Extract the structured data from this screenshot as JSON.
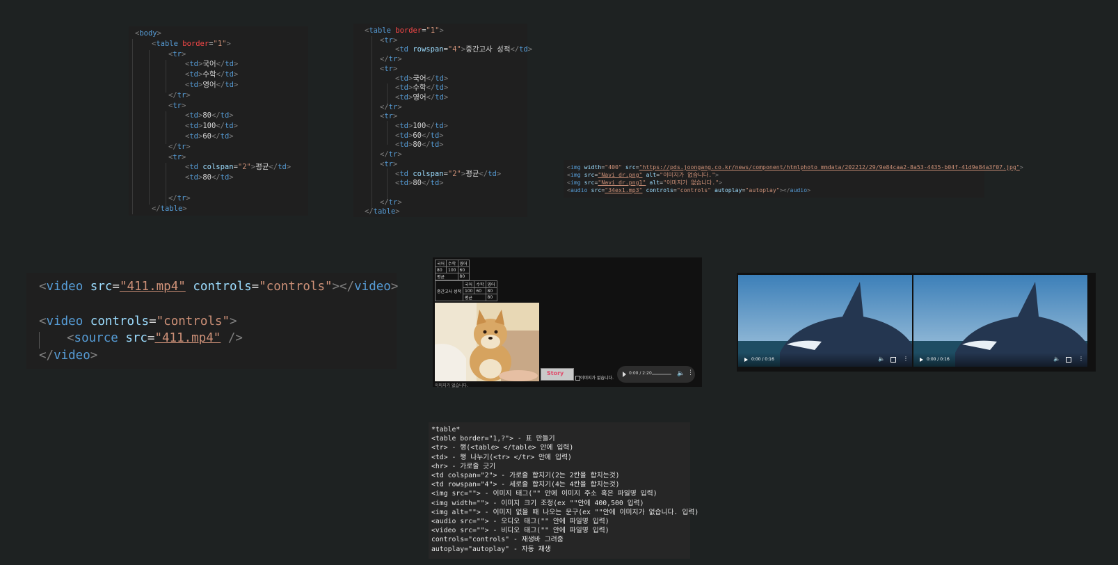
{
  "snippet1": {
    "lines": [
      {
        "p": [
          "<",
          "body",
          ">"
        ]
      },
      {
        "p": [
          "<",
          "table",
          " ",
          "border",
          "=",
          "\"1\"",
          ">"
        ]
      },
      {
        "p": [
          "<",
          "tr",
          ">"
        ]
      },
      {
        "p": [
          "<",
          "td",
          ">",
          "국어",
          "</",
          "td",
          ">"
        ]
      },
      {
        "p": [
          "<",
          "td",
          ">",
          "수학",
          "</",
          "td",
          ">"
        ]
      },
      {
        "p": [
          "<",
          "td",
          ">",
          "영어",
          "</",
          "td",
          ">"
        ]
      },
      {
        "p": [
          "</",
          "tr",
          ">"
        ]
      },
      {
        "p": [
          "<",
          "tr",
          ">"
        ]
      },
      {
        "p": [
          "<",
          "td",
          ">",
          "80",
          "</",
          "td",
          ">"
        ]
      },
      {
        "p": [
          "<",
          "td",
          ">",
          "100",
          "</",
          "td",
          ">"
        ]
      },
      {
        "p": [
          "<",
          "td",
          ">",
          "60",
          "</",
          "td",
          ">"
        ]
      },
      {
        "p": [
          "</",
          "tr",
          ">"
        ]
      },
      {
        "p": [
          "<",
          "tr",
          ">"
        ]
      },
      {
        "p": [
          "<",
          "td",
          " ",
          "colspan",
          "=",
          "\"2\"",
          ">",
          "평균",
          "</",
          "td",
          ">"
        ]
      },
      {
        "p": [
          "<",
          "td",
          ">",
          "80",
          "</",
          "td",
          ">"
        ]
      },
      {
        "p": [
          ""
        ]
      },
      {
        "p": [
          "</",
          "tr",
          ">"
        ]
      },
      {
        "p": [
          "</",
          "table",
          ">"
        ]
      }
    ]
  },
  "snippet2": {
    "lines": [
      {
        "p": [
          "<",
          "table",
          " ",
          "border",
          "=",
          "\"1\"",
          ">"
        ]
      },
      {
        "p": [
          "<",
          "tr",
          ">"
        ]
      },
      {
        "p": [
          "<",
          "td",
          " ",
          "rowspan",
          "=",
          "\"4\"",
          ">",
          "중간고사 성적",
          "</",
          "td",
          ">"
        ]
      },
      {
        "p": [
          "</",
          "tr",
          ">"
        ]
      },
      {
        "p": [
          "<",
          "tr",
          ">"
        ]
      },
      {
        "p": [
          "<",
          "td",
          ">",
          "국어",
          "</",
          "td",
          ">"
        ]
      },
      {
        "p": [
          "<",
          "td",
          ">",
          "수학",
          "</",
          "td",
          ">"
        ]
      },
      {
        "p": [
          "<",
          "td",
          ">",
          "영어",
          "</",
          "td",
          ">"
        ]
      },
      {
        "p": [
          "</",
          "tr",
          ">"
        ]
      },
      {
        "p": [
          "<",
          "tr",
          ">"
        ]
      },
      {
        "p": [
          "<",
          "td",
          ">",
          "100",
          "</",
          "td",
          ">"
        ]
      },
      {
        "p": [
          "<",
          "td",
          ">",
          "60",
          "</",
          "td",
          ">"
        ]
      },
      {
        "p": [
          "<",
          "td",
          ">",
          "80",
          "</",
          "td",
          ">"
        ]
      },
      {
        "p": [
          "</",
          "tr",
          ">"
        ]
      },
      {
        "p": [
          "<",
          "tr",
          ">"
        ]
      },
      {
        "p": [
          "<",
          "td",
          " ",
          "colspan",
          "=",
          "\"2\"",
          ">",
          "평균",
          "</",
          "td",
          ">"
        ]
      },
      {
        "p": [
          "<",
          "td",
          ">",
          "80",
          "</",
          "td",
          ">"
        ]
      },
      {
        "p": [
          ""
        ]
      },
      {
        "p": [
          "</",
          "tr",
          ">"
        ]
      },
      {
        "p": [
          "</",
          "table",
          ">"
        ]
      }
    ]
  },
  "snippet3": {
    "lines": [
      {
        "p": [
          "<",
          "img",
          " ",
          "width",
          "=",
          "\"400\"",
          " ",
          "src",
          "=",
          "\"https://pds.joongang.co.kr/news/component/htmlphoto_mmdata/202212/29/9e84caa2-8a53-4435-b04f-41d9e84a3f07.jpg\"",
          ">"
        ]
      },
      {
        "p": [
          "<",
          "img",
          " ",
          "src",
          "=",
          "\"Navi_dr.png\"",
          " ",
          "alt",
          "=",
          "\"이미지가 없습니다.\"",
          ">"
        ]
      },
      {
        "p": [
          "<",
          "img",
          " ",
          "src",
          "=",
          "\"Navi_dr.png1\"",
          " ",
          "alt",
          "=",
          "\"이미지가 없습니다.\"",
          ">"
        ]
      },
      {
        "p": [
          "<",
          "audio",
          " ",
          "src",
          "=",
          "\"34ex1.mp3\"",
          " ",
          "controls",
          "=",
          "\"controls\"",
          " ",
          "autoplay",
          "=",
          "\"autoplay\"",
          "></",
          "audio",
          ">"
        ]
      }
    ]
  },
  "snippet4": {
    "lines": [
      {
        "p": [
          "<",
          "video",
          " ",
          "src",
          "=",
          "\"411.mp4\"",
          " ",
          "controls",
          "=",
          "\"controls\"",
          "></",
          "video",
          ">"
        ]
      },
      {
        "p": [
          ""
        ]
      },
      {
        "p": [
          "<",
          "video",
          " ",
          "controls",
          "=",
          "\"controls\"",
          ">"
        ]
      },
      {
        "p": [
          "<",
          "source",
          " ",
          "src",
          "=",
          "\"411.mp4\"",
          " ",
          "/>"
        ]
      },
      {
        "p": [
          "</",
          "video",
          ">"
        ]
      }
    ]
  },
  "preview": {
    "table1": [
      [
        "국어",
        "수학",
        "영어"
      ],
      [
        "80",
        "100",
        "60"
      ],
      [
        "평균",
        "80"
      ]
    ],
    "table2_left": "중간고사 성적",
    "table2": [
      [
        "국어",
        "수학",
        "영어"
      ],
      [
        "100",
        "60",
        "80"
      ],
      [
        "평균",
        "80"
      ]
    ],
    "alt_text_1": "이미지가 없습니다.",
    "alt_text_2": "이미지가 없습니다.",
    "story_label": "Story",
    "audio_time": "0:00 / 2:20"
  },
  "videos": [
    {
      "time": "0:00 / 0:16"
    },
    {
      "time": "0:00 / 0:16"
    }
  ],
  "notes": {
    "lines": [
      "*table*",
      "<table border=\"1,?\"> - 표 만들기",
      "<tr> - 행(<table> </table> 안에 입력)",
      "<td> - 행 나누기(<tr> </tr> 안에 입력)",
      "<hr> - 가로줄 긋기",
      "<td colspan=\"2\"> - 가로줄 합치기(2는 2칸을 합치는것)",
      "<td rowspan=\"4\"> - 세로줄 합치기(4는 4칸을 합치는것)",
      "<img src=\"\"> - 이미지 태그(\"\" 안에 이미지 주소 혹은 파일명 입력)",
      "<img width=\"\"> - 이미지 크기 조정(ex \"\"안에 400,500 입력)",
      "<img alt=\"\"> - 이미지 없을 때 나오는 문구(ex \"\"안에 이미지가 없습니다. 입력)",
      "<audio src=\"\"> - 오디오 태그(\"\" 안에 파일명 입력)",
      "<video src=\"\"> - 비디오 태그(\"\" 안에 파일명 입력)",
      "controls=\"controls\" - 재생바 그려줌",
      "autoplay=\"autoplay\" - 자동 재생"
    ]
  }
}
